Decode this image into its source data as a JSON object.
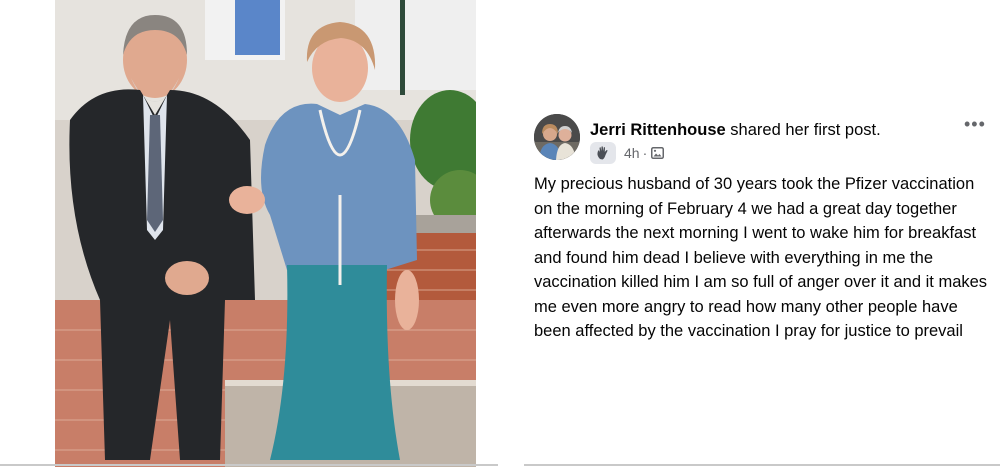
{
  "post": {
    "author_name": "Jerri Rittenhouse",
    "action_text": "shared her first post.",
    "time": "4h",
    "separator": "·",
    "audience_icon": "public-album-icon",
    "badge_icon": "wave-hand-icon",
    "more_label": "•••",
    "body": "My precious husband of 30 years took the Pfizer vaccination on the morning of February 4 we had a great day together afterwards the next morning I went to wake him for breakfast and found him dead I believe with everything in me the vaccination killed him I am so full of anger over it and it makes me even more angry to read how many other people have been affected by the vaccination I pray for justice to prevail"
  },
  "colors": {
    "text": "#050505",
    "secondary_text": "#65676b",
    "badge_bg": "#e4e6eb"
  }
}
